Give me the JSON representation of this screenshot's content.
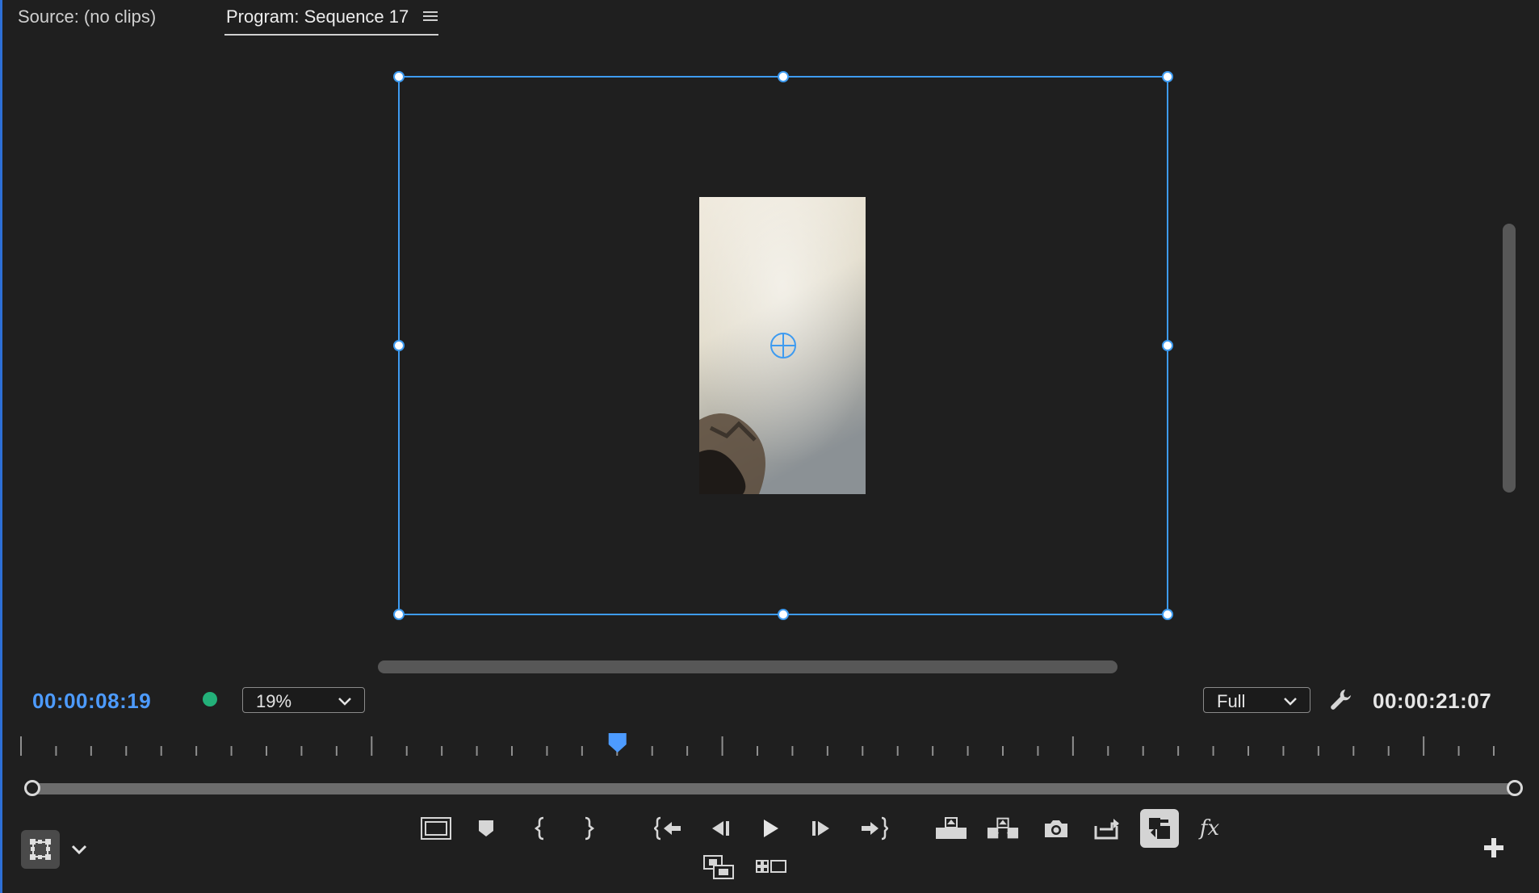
{
  "tabs": {
    "source": "Source: (no clips)",
    "program": "Program: Sequence 17"
  },
  "playback": {
    "current_timecode": "00:00:08:19",
    "duration_timecode": "00:00:21:07",
    "zoom": "19%",
    "resolution": "Full",
    "playhead_fraction": 0.405
  },
  "colors": {
    "accent": "#4d9bff",
    "transform_outline": "#3e9bf0",
    "status_dot": "#23b079"
  },
  "icons": {
    "panel_menu": "hamburger-icon",
    "settings": "wrench-icon",
    "transform": "transform-icon",
    "add": "plus-icon"
  },
  "transport_buttons": [
    "safe-margins",
    "add-marker",
    "mark-in",
    "mark-out",
    "go-to-in",
    "step-back",
    "play",
    "step-forward",
    "go-to-out",
    "lift",
    "extract",
    "export-frame",
    "insert",
    "overlay",
    "comparison-view",
    "fx-toggle",
    "toggle-multicam",
    "button-editor"
  ]
}
